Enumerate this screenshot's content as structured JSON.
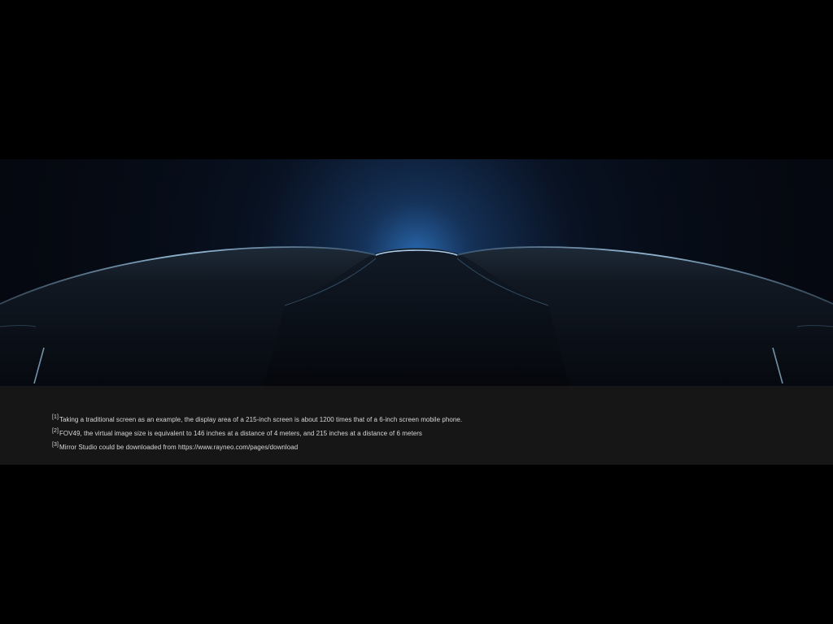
{
  "hero": {
    "image": "vr-headset-silhouette-icon",
    "glow_color": "#2f7fd0"
  },
  "footnotes": [
    {
      "marker": "[1]",
      "text": "Taking a traditional screen as an example, the display area of a 215-inch screen is about 1200 times that of a 6-inch screen mobile phone."
    },
    {
      "marker": "[2]",
      "text": "FOV49, the virtual image size is equivalent to 146 inches at a distance of 4 meters, and 215 inches at a distance of 6 meters"
    },
    {
      "marker": "[3]",
      "text": "Mirror Studio could be downloaded from https://www.rayneo.com/pages/download"
    }
  ]
}
